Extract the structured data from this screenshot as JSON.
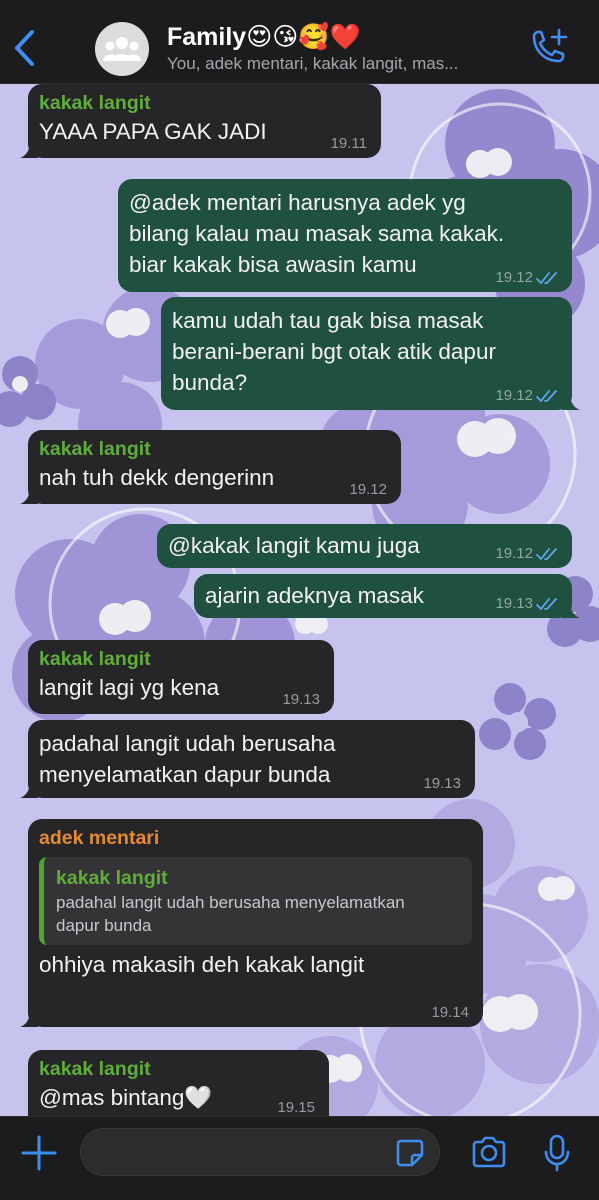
{
  "header": {
    "title": "Family😍😘🥰❤️",
    "subtitle": "You, adek mentari, kakak langit, mas..."
  },
  "messages": [
    {
      "dir": "in",
      "sender": "kakak langit",
      "lines": [
        "YAAA PAPA GAK JADI"
      ],
      "time": "19.11"
    },
    {
      "dir": "out",
      "lines": [
        "@adek mentari harusnya adek yg",
        "bilang kalau mau masak sama kakak.",
        "biar kakak bisa awasin kamu"
      ],
      "time": "19.12"
    },
    {
      "dir": "out",
      "lines": [
        "kamu udah tau gak bisa masak",
        "berani-berani bgt otak atik dapur",
        "bunda?"
      ],
      "time": "19.12"
    },
    {
      "dir": "in",
      "sender": "kakak langit",
      "lines": [
        "nah tuh dekk dengerinn"
      ],
      "time": "19.12"
    },
    {
      "dir": "out",
      "lines": [
        "@kakak langit kamu juga"
      ],
      "time": "19.12"
    },
    {
      "dir": "out",
      "lines": [
        "ajarin adeknya masak"
      ],
      "time": "19.13"
    },
    {
      "dir": "in",
      "sender": "kakak langit",
      "lines": [
        "langit lagi yg kena"
      ],
      "time": "19.13"
    },
    {
      "dir": "in",
      "lines": [
        "padahal langit udah berusaha",
        "menyelamatkan dapur bunda"
      ],
      "time": "19.13"
    },
    {
      "dir": "in",
      "sender": "adek mentari",
      "quote": {
        "name": "kakak langit",
        "lines": [
          "padahal langit udah berusaha menyelamatkan",
          "dapur bunda"
        ]
      },
      "lines": [
        "ohhiya makasih deh kakak langit"
      ],
      "time": "19.14"
    },
    {
      "dir": "in",
      "sender": "kakak langit",
      "lines": [
        "@mas bintang🤍"
      ],
      "time": "19.15"
    }
  ],
  "colors": {
    "incoming_bubble": "#262629",
    "outgoing_bubble": "#1f5040",
    "sender_green": "#5fae38",
    "sender_orange": "#e58a30",
    "read_ticks": "#5fa8e8",
    "accent_blue": "#3d8ef0"
  },
  "icons": {
    "back": "chevron-left-icon",
    "avatar": "group-icon",
    "call": "phone-plus-icon",
    "attach": "plus-icon",
    "sticker": "sticker-icon",
    "camera": "camera-icon",
    "mic": "microphone-icon"
  }
}
